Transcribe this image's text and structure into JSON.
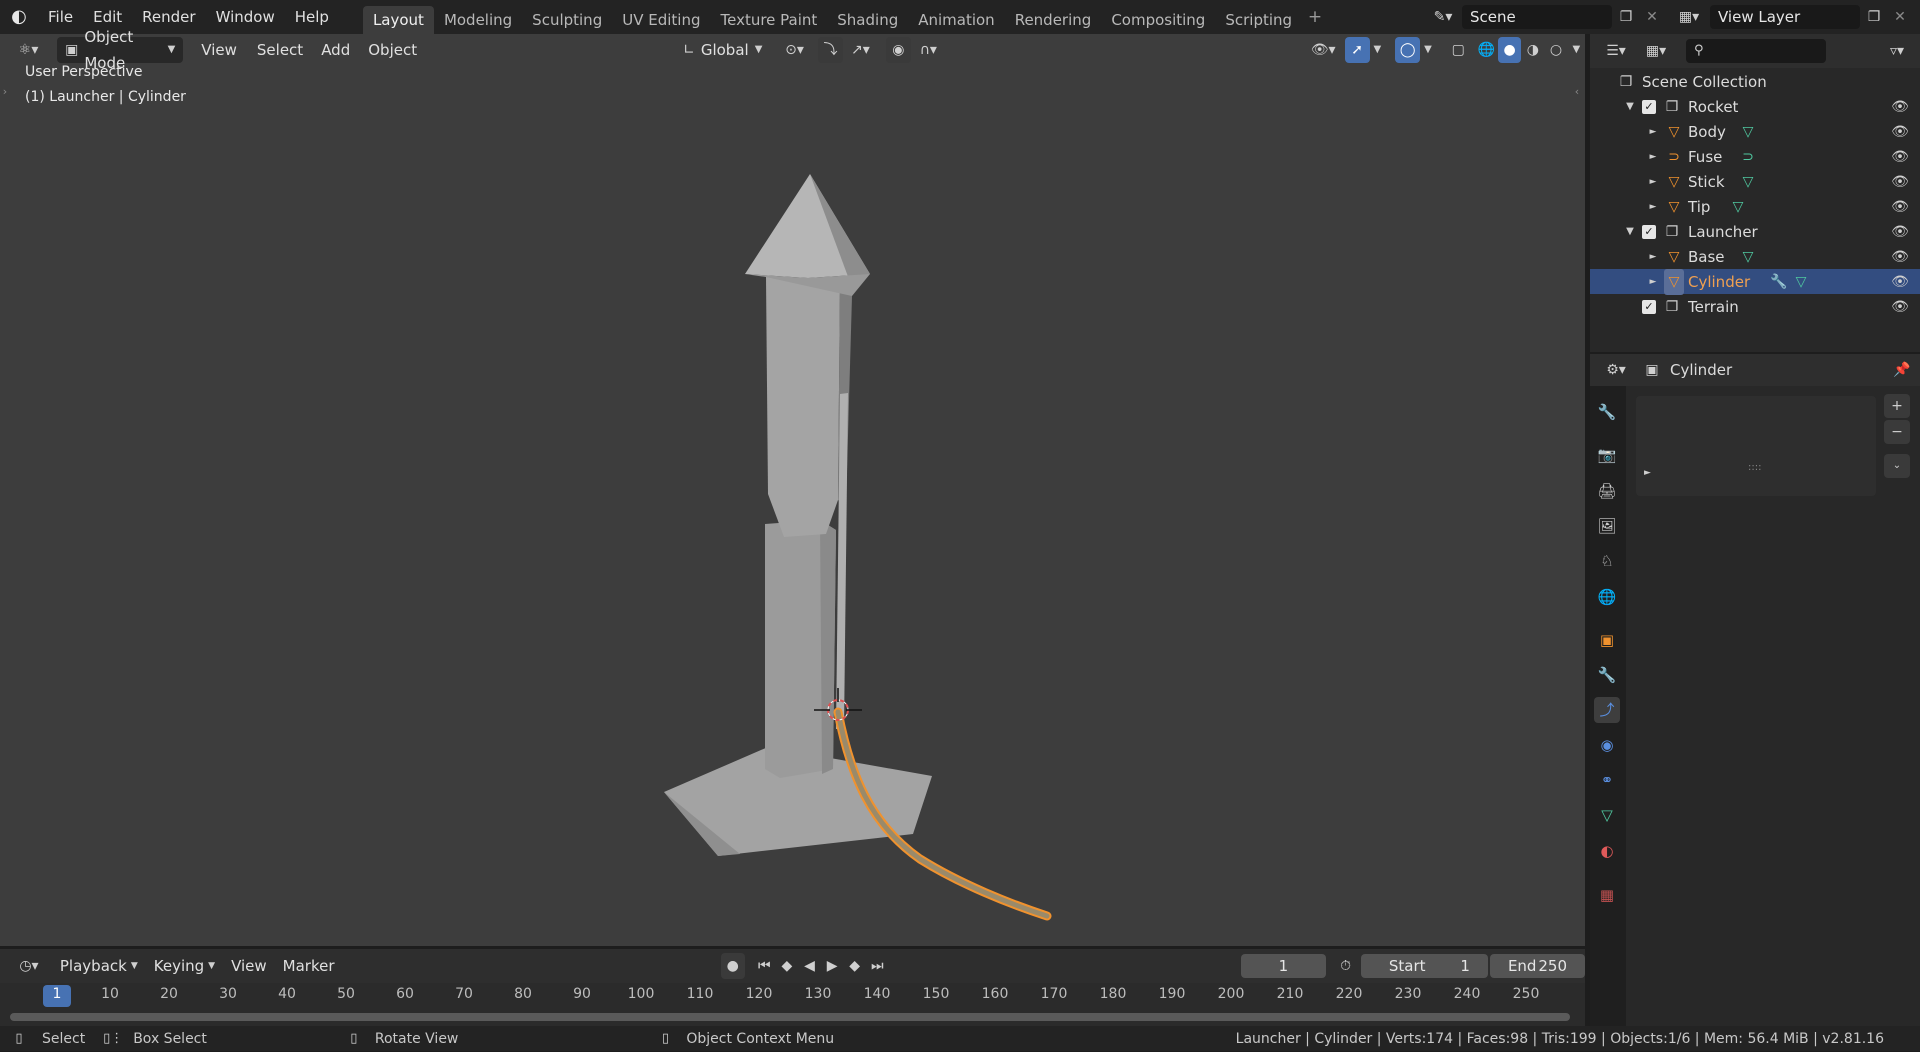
{
  "topbar": {
    "menus": [
      "File",
      "Edit",
      "Render",
      "Window",
      "Help"
    ],
    "workspaces": [
      "Layout",
      "Modeling",
      "Sculpting",
      "UV Editing",
      "Texture Paint",
      "Shading",
      "Animation",
      "Rendering",
      "Compositing",
      "Scripting"
    ],
    "active_workspace": "Layout",
    "add_workspace": "+",
    "scene_name": "Scene",
    "view_layer_name": "View Layer"
  },
  "viewport_header": {
    "mode": "Object Mode",
    "menus": [
      "View",
      "Select",
      "Add",
      "Object"
    ],
    "orientation": "Global"
  },
  "viewport": {
    "perspective_label": "User Perspective",
    "object_label": "(1) Launcher | Cylinder"
  },
  "outliner": {
    "search_placeholder": "",
    "root": "Scene Collection",
    "rows": [
      {
        "name": "Rocket",
        "type": "collection",
        "indent": 1,
        "expanded": true
      },
      {
        "name": "Body",
        "type": "mesh",
        "indent": 2
      },
      {
        "name": "Fuse",
        "type": "curve",
        "indent": 2
      },
      {
        "name": "Stick",
        "type": "mesh",
        "indent": 2
      },
      {
        "name": "Tip",
        "type": "mesh",
        "indent": 2
      },
      {
        "name": "Launcher",
        "type": "collection",
        "indent": 1,
        "expanded": true
      },
      {
        "name": "Base",
        "type": "mesh",
        "indent": 2
      },
      {
        "name": "Cylinder",
        "type": "mesh",
        "indent": 2,
        "selected": true
      },
      {
        "name": "Terrain",
        "type": "collection",
        "indent": 1
      }
    ]
  },
  "properties": {
    "object_name": "Cylinder",
    "list_grip": "::::"
  },
  "timeline": {
    "menus": [
      "Playback",
      "Keying",
      "View",
      "Marker"
    ],
    "current_frame": "1",
    "start_label": "Start",
    "start_value": "1",
    "end_label": "End",
    "end_value": "250",
    "ticks": [
      "1",
      "10",
      "20",
      "30",
      "40",
      "50",
      "60",
      "70",
      "80",
      "90",
      "100",
      "110",
      "120",
      "130",
      "140",
      "150",
      "160",
      "170",
      "180",
      "190",
      "200",
      "210",
      "220",
      "230",
      "240",
      "250"
    ]
  },
  "statusbar": {
    "select": "Select",
    "box_select": "Box Select",
    "rotate_view": "Rotate View",
    "context_menu": "Object Context Menu",
    "stats": "Launcher | Cylinder | Verts:174 | Faces:98 | Tris:199 | Objects:1/6 | Mem: 56.4 MiB | v2.81.16"
  },
  "colors": {
    "accent": "#4772b3",
    "selection": "#334d80",
    "object_orange": "#f0922e",
    "mesh_green": "#50c8a0"
  }
}
